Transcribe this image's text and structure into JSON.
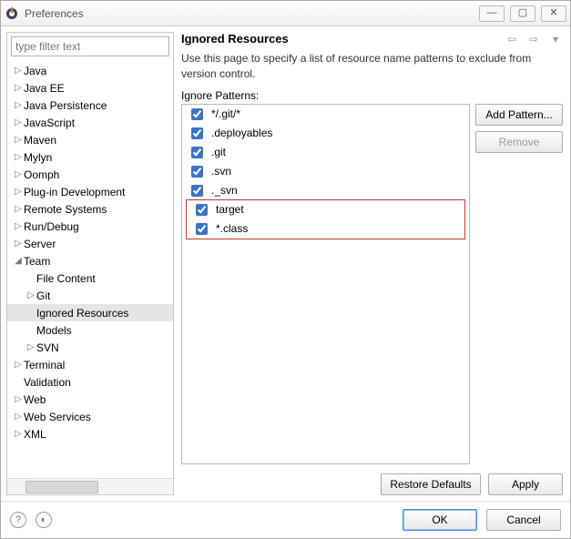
{
  "window": {
    "title": "Preferences"
  },
  "filter": {
    "placeholder": "type filter text"
  },
  "tree": [
    {
      "label": "Java",
      "depth": 0,
      "twisty": "▷"
    },
    {
      "label": "Java EE",
      "depth": 0,
      "twisty": "▷"
    },
    {
      "label": "Java Persistence",
      "depth": 0,
      "twisty": "▷"
    },
    {
      "label": "JavaScript",
      "depth": 0,
      "twisty": "▷"
    },
    {
      "label": "Maven",
      "depth": 0,
      "twisty": "▷"
    },
    {
      "label": "Mylyn",
      "depth": 0,
      "twisty": "▷"
    },
    {
      "label": "Oomph",
      "depth": 0,
      "twisty": "▷"
    },
    {
      "label": "Plug-in Development",
      "depth": 0,
      "twisty": "▷"
    },
    {
      "label": "Remote Systems",
      "depth": 0,
      "twisty": "▷"
    },
    {
      "label": "Run/Debug",
      "depth": 0,
      "twisty": "▷"
    },
    {
      "label": "Server",
      "depth": 0,
      "twisty": "▷"
    },
    {
      "label": "Team",
      "depth": 0,
      "twisty": "◢"
    },
    {
      "label": "File Content",
      "depth": 1,
      "twisty": ""
    },
    {
      "label": "Git",
      "depth": 1,
      "twisty": "▷"
    },
    {
      "label": "Ignored Resources",
      "depth": 1,
      "twisty": "",
      "selected": true
    },
    {
      "label": "Models",
      "depth": 1,
      "twisty": ""
    },
    {
      "label": "SVN",
      "depth": 1,
      "twisty": "▷"
    },
    {
      "label": "Terminal",
      "depth": 0,
      "twisty": "▷"
    },
    {
      "label": "Validation",
      "depth": 0,
      "twisty": ""
    },
    {
      "label": "Web",
      "depth": 0,
      "twisty": "▷"
    },
    {
      "label": "Web Services",
      "depth": 0,
      "twisty": "▷"
    },
    {
      "label": "XML",
      "depth": 0,
      "twisty": "▷"
    }
  ],
  "page": {
    "title": "Ignored Resources",
    "description": "Use this page to specify a list of resource name patterns to exclude from version control.",
    "patterns_label": "Ignore Patterns:"
  },
  "patterns": [
    {
      "text": "*/.git/*",
      "checked": true
    },
    {
      "text": ".deployables",
      "checked": true
    },
    {
      "text": ".git",
      "checked": true
    },
    {
      "text": ".svn",
      "checked": true
    },
    {
      "text": "._svn",
      "checked": true
    },
    {
      "text": "target",
      "checked": true,
      "highlight": true
    },
    {
      "text": "*.class",
      "checked": true,
      "highlight": true
    }
  ],
  "buttons": {
    "add": "Add Pattern...",
    "remove": "Remove",
    "restore": "Restore Defaults",
    "apply": "Apply",
    "ok": "OK",
    "cancel": "Cancel"
  }
}
